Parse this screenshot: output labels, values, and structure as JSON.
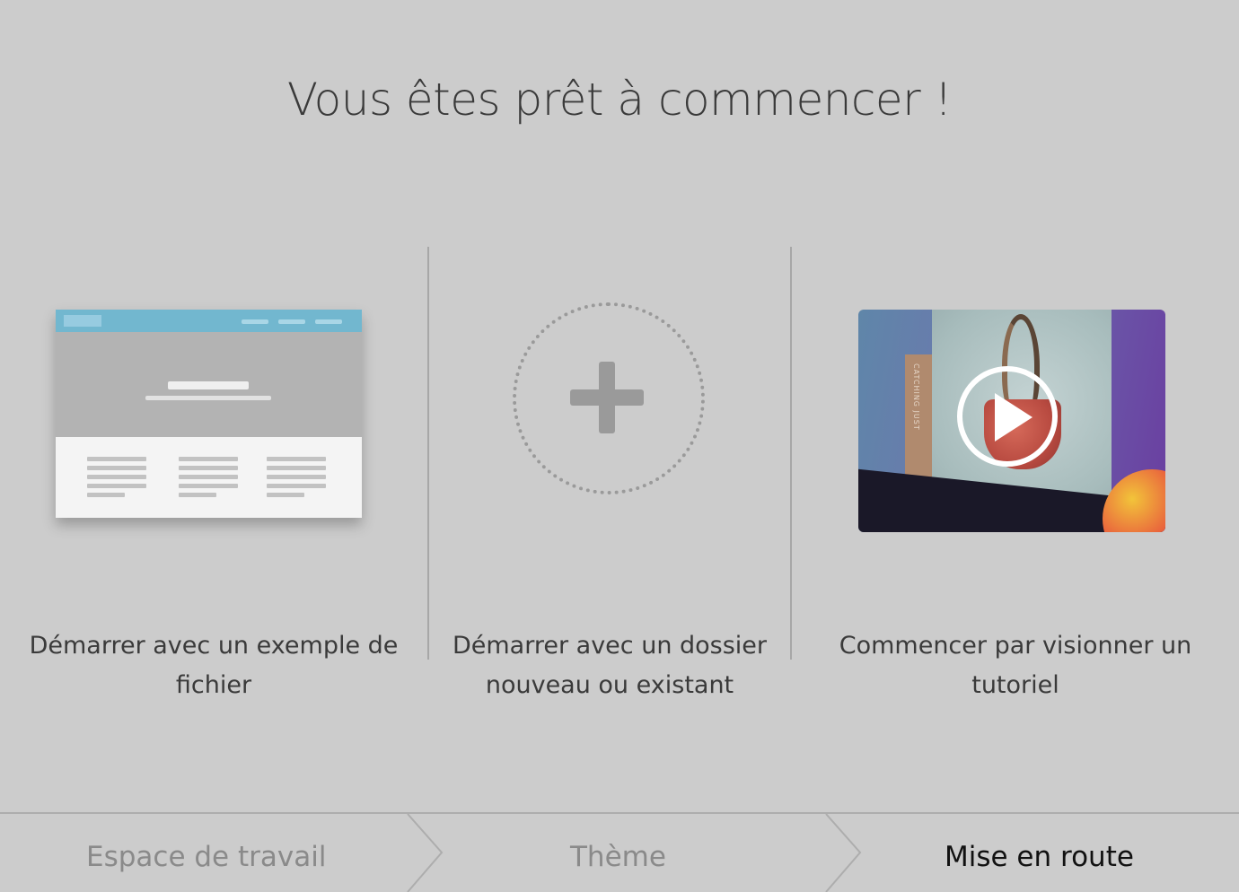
{
  "title": "Vous êtes prêt à commencer !",
  "options": [
    {
      "label": "Démarrer avec un exemple de fichier"
    },
    {
      "label": "Démarrer avec un dossier nouveau ou existant"
    },
    {
      "label": "Commencer par visionner un tutoriel"
    }
  ],
  "video": {
    "poster_text": "CATCHING JUST"
  },
  "steps": [
    {
      "label": "Espace de travail",
      "state": "done"
    },
    {
      "label": "Thème",
      "state": "done"
    },
    {
      "label": "Mise en route",
      "state": "active"
    }
  ],
  "colors": {
    "background": "#cccccc",
    "sample_header": "#72b7cf",
    "active_step": "#111111",
    "inactive_step": "#8a8a8a"
  }
}
